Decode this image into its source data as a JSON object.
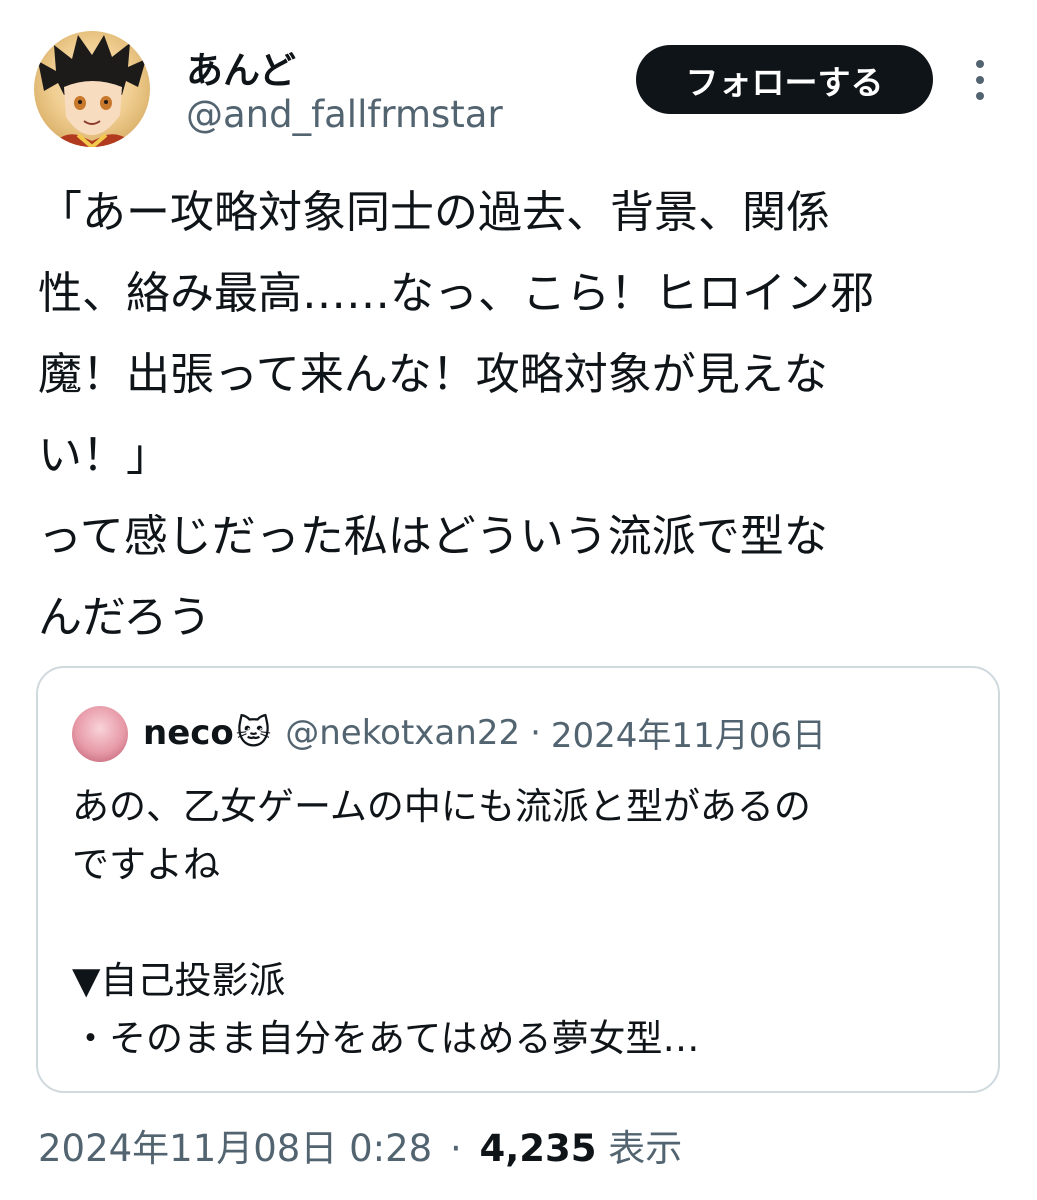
{
  "author": {
    "name": "あんど",
    "handle": "@and_fallfrmstar"
  },
  "follow_label": "フォローする",
  "more_icon": "more-vertical-icon",
  "tweet_lines": [
    "「あー攻略対象同士の過去、背景、関係",
    "性、絡み最高……なっ、こら！ヒロイン邪",
    "魔！出張って来んな！攻略対象が見えな",
    "い！」",
    "って感じだった私はどういう流派で型な",
    "んだろう"
  ],
  "quote": {
    "name": "neco",
    "emoji": "🐱",
    "handle": "@nekotxan22",
    "separator": "·",
    "date": "2024年11月06日",
    "lines": [
      "あの、乙女ゲームの中にも流派と型があるの",
      "ですよね",
      "",
      "▼自己投影派",
      "・そのまま自分をあてはめる夢女型…"
    ]
  },
  "footer": {
    "timestamp": "2024年11月08日 0:28",
    "separator": "·",
    "views_count": "4,235",
    "views_label": "表示"
  }
}
